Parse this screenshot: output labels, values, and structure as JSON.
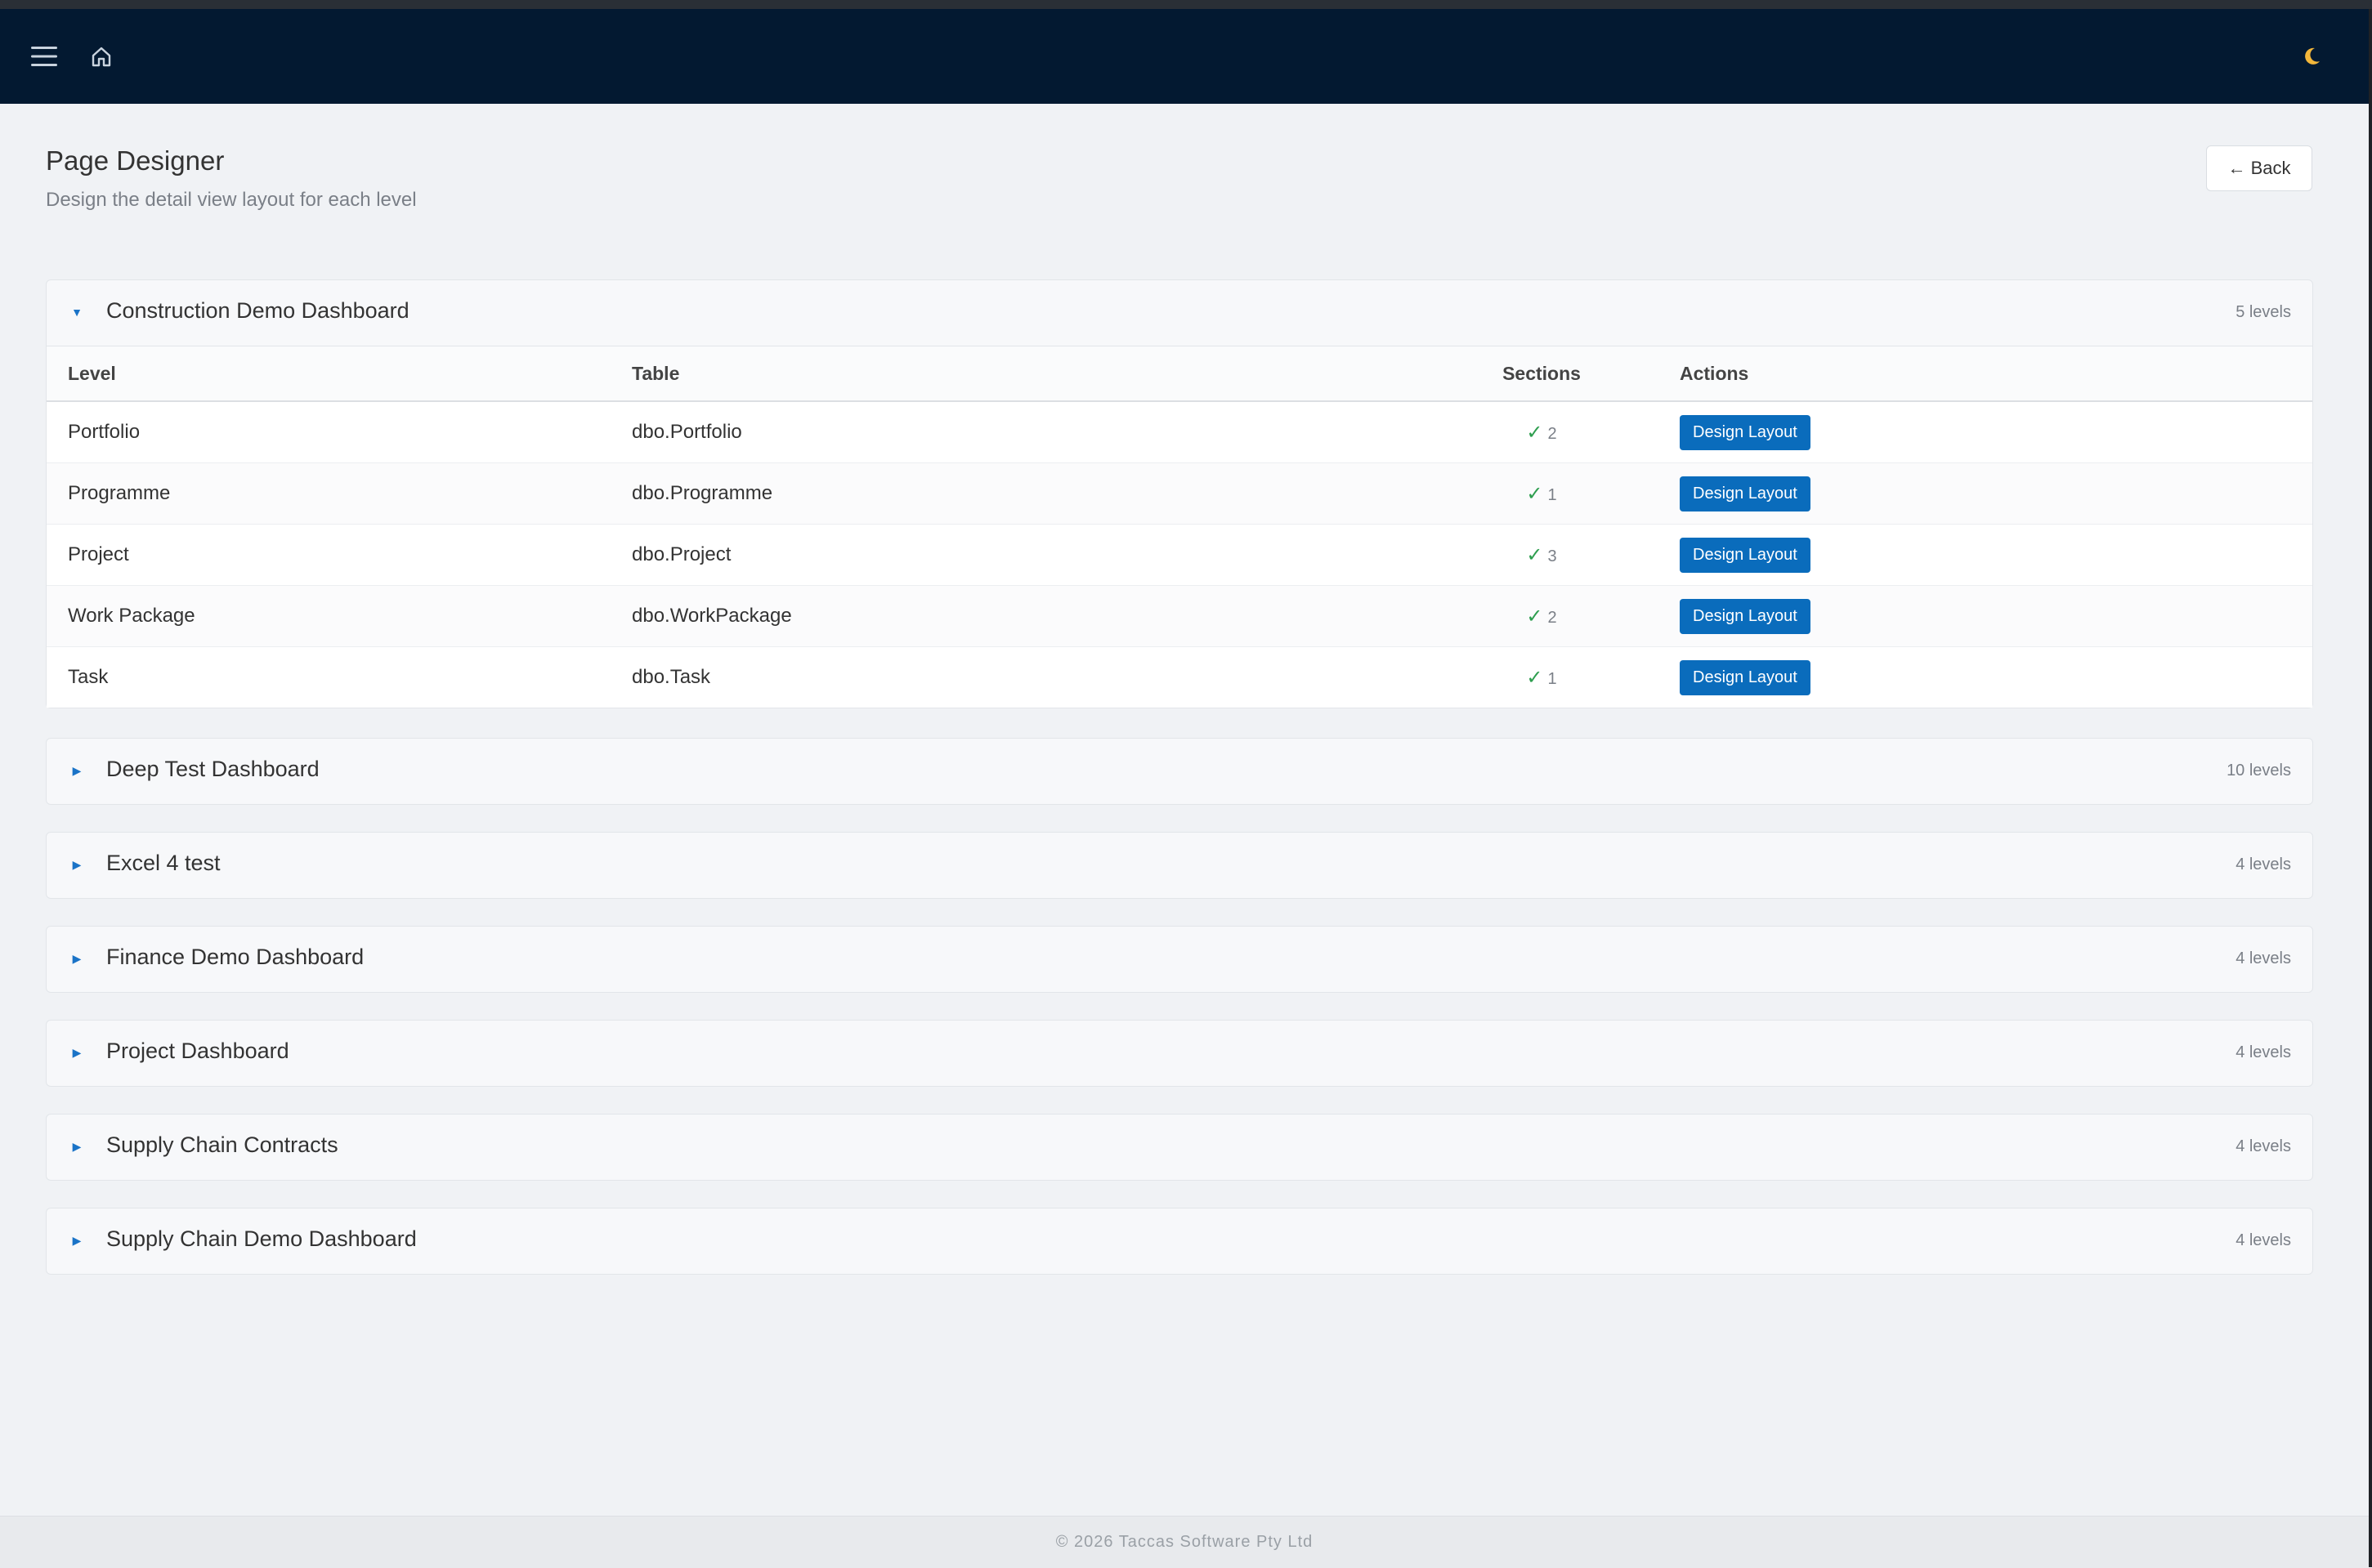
{
  "navbar": {
    "menu_icon": "hamburger-menu-icon",
    "home_icon": "home-icon",
    "theme_icon": "moon-icon",
    "background": "#031931"
  },
  "page": {
    "title": "Page Designer",
    "subtitle": "Design the detail view layout for each level",
    "back_label": "← Back"
  },
  "table_headers": {
    "level": "Level",
    "table": "Table",
    "sections": "Sections",
    "actions": "Actions"
  },
  "groups": [
    {
      "name": "Construction Demo Dashboard",
      "count": "5 levels",
      "expanded": true,
      "rows": [
        {
          "level": "Portfolio",
          "table": "dbo.Portfolio",
          "sections": "2",
          "action": "Design Layout"
        },
        {
          "level": "Programme",
          "table": "dbo.Programme",
          "sections": "1",
          "action": "Design Layout"
        },
        {
          "level": "Project",
          "table": "dbo.Project",
          "sections": "3",
          "action": "Design Layout"
        },
        {
          "level": "Work Package",
          "table": "dbo.WorkPackage",
          "sections": "2",
          "action": "Design Layout"
        },
        {
          "level": "Task",
          "table": "dbo.Task",
          "sections": "1",
          "action": "Design Layout"
        }
      ]
    },
    {
      "name": "Deep Test Dashboard",
      "count": "10 levels",
      "expanded": false
    },
    {
      "name": "Excel 4 test",
      "count": "4 levels",
      "expanded": false
    },
    {
      "name": "Finance Demo Dashboard",
      "count": "4 levels",
      "expanded": false
    },
    {
      "name": "Project Dashboard",
      "count": "4 levels",
      "expanded": false
    },
    {
      "name": "Supply Chain Contracts",
      "count": "4 levels",
      "expanded": false
    },
    {
      "name": "Supply Chain Demo Dashboard",
      "count": "4 levels",
      "expanded": false
    }
  ],
  "check_symbol": "✓",
  "footer": {
    "text": "© 2026 Taccas Software Pty Ltd"
  },
  "colors": {
    "accent": "#0a6cbc",
    "check": "#2e9e4f",
    "page_bg": "#f0f2f5"
  }
}
